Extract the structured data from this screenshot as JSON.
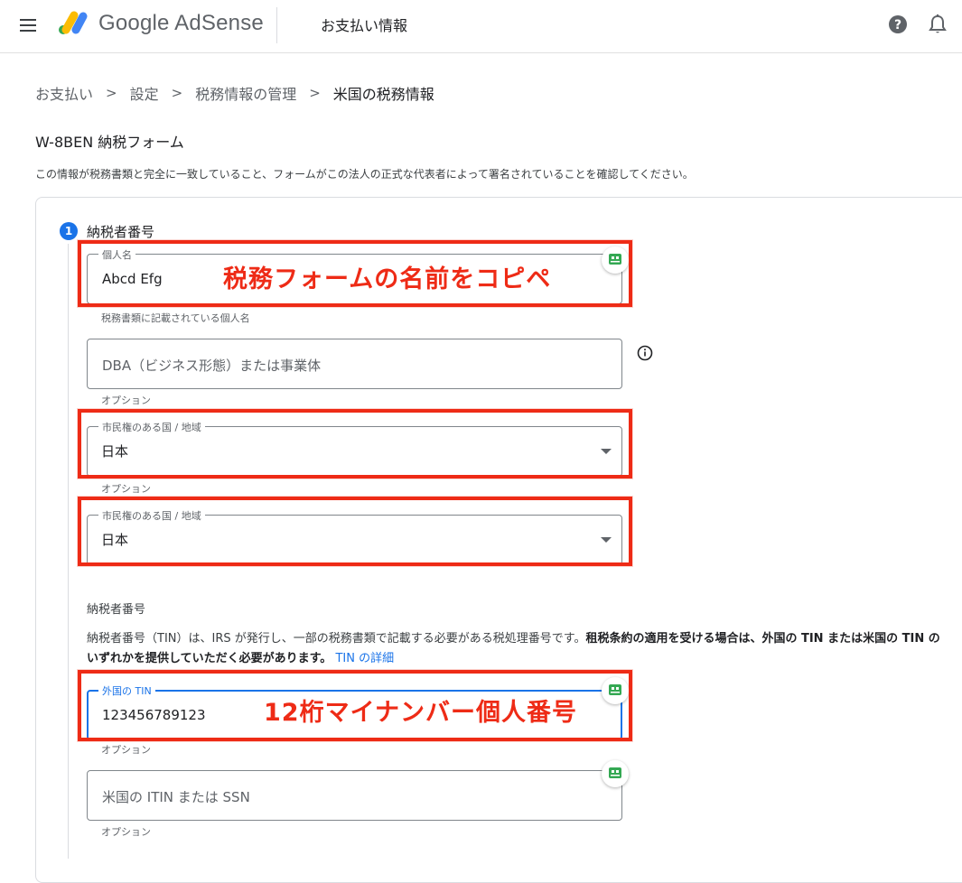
{
  "header": {
    "brand": "Google AdSense",
    "page_title": "お支払い情報",
    "icons": [
      "menu-icon",
      "adsense-logo-icon",
      "help-icon",
      "bell-icon"
    ]
  },
  "breadcrumb": [
    "お支払い",
    "設定",
    "税務情報の管理",
    "米国の税務情報"
  ],
  "form": {
    "title": "W-8BEN 納税フォーム",
    "description": "この情報が税務書類と完全に一致していること、フォームがこの法人の正式な代表者によって署名されていることを確認してください。"
  },
  "step": {
    "number": "1",
    "title": "納税者番号"
  },
  "fields": {
    "name": {
      "label": "個人名",
      "value": "Abcd Efg",
      "hint": "税務書類に記載されている個人名"
    },
    "dba": {
      "placeholder": "DBA（ビジネス形態）または事業体",
      "hint": "オプション"
    },
    "citizenship1": {
      "label": "市民権のある国 / 地域",
      "value": "日本",
      "hint": "オプション"
    },
    "citizenship2": {
      "label": "市民権のある国 / 地域",
      "value": "日本"
    },
    "foreign_tin": {
      "label": "外国の TIN",
      "value": "123456789123",
      "hint": "オプション"
    },
    "us_tin": {
      "placeholder": "米国の ITIN または SSN",
      "hint": "オプション"
    }
  },
  "taxpayer": {
    "subtitle": "納税者番号",
    "text": "納税者番号（TIN）は、IRS が発行し、一部の税務書類で記載する必要がある税処理番号です。",
    "bold_text": "租税条約の適用を受ける場合は、外国の TIN または米国の TIN のいずれかを提供していただく必要があります。",
    "link": "TIN の詳細"
  },
  "annotations": {
    "name_note": "税務フォームの名前をコピペ",
    "tin_note": "12桁マイナンバー個人番号",
    "color": "#ee2b16"
  },
  "colors": {
    "accent": "#1a73e8",
    "annotation": "#ee2b16"
  }
}
